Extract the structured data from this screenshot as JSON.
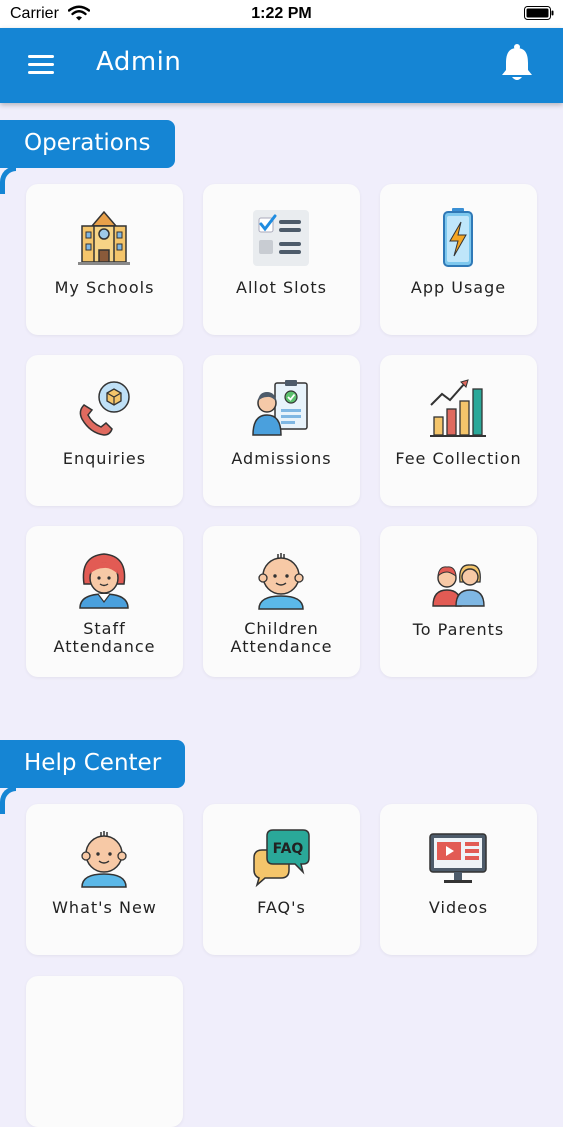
{
  "status_bar": {
    "carrier": "Carrier",
    "time": "1:22 PM"
  },
  "app_bar": {
    "title": "Admin"
  },
  "sections": {
    "operations": {
      "title": "Operations",
      "cards": [
        {
          "label": "My Schools",
          "icon": "school-building-icon"
        },
        {
          "label": "Allot Slots",
          "icon": "checklist-icon"
        },
        {
          "label": "App Usage",
          "icon": "battery-charging-icon"
        },
        {
          "label": "Enquiries",
          "icon": "phone-call-icon"
        },
        {
          "label": "Admissions",
          "icon": "admission-form-icon"
        },
        {
          "label": "Fee Collection",
          "icon": "bar-chart-icon"
        },
        {
          "label_line1": "Staff",
          "label_line2": "Attendance",
          "icon": "staff-woman-icon"
        },
        {
          "label_line1": "Children",
          "label_line2": "Attendance",
          "icon": "child-face-icon"
        },
        {
          "label": "To Parents",
          "icon": "parents-icon"
        }
      ]
    },
    "help_center": {
      "title": "Help Center",
      "cards": [
        {
          "label": "What's New",
          "icon": "baby-face-icon"
        },
        {
          "label": "FAQ's",
          "icon": "faq-bubble-icon",
          "icon_text": "FAQ"
        },
        {
          "label": "Videos",
          "icon": "video-monitor-icon"
        }
      ]
    }
  },
  "colors": {
    "primary": "#1585d4",
    "background": "#f0eefb",
    "card": "#fbfbfb"
  }
}
